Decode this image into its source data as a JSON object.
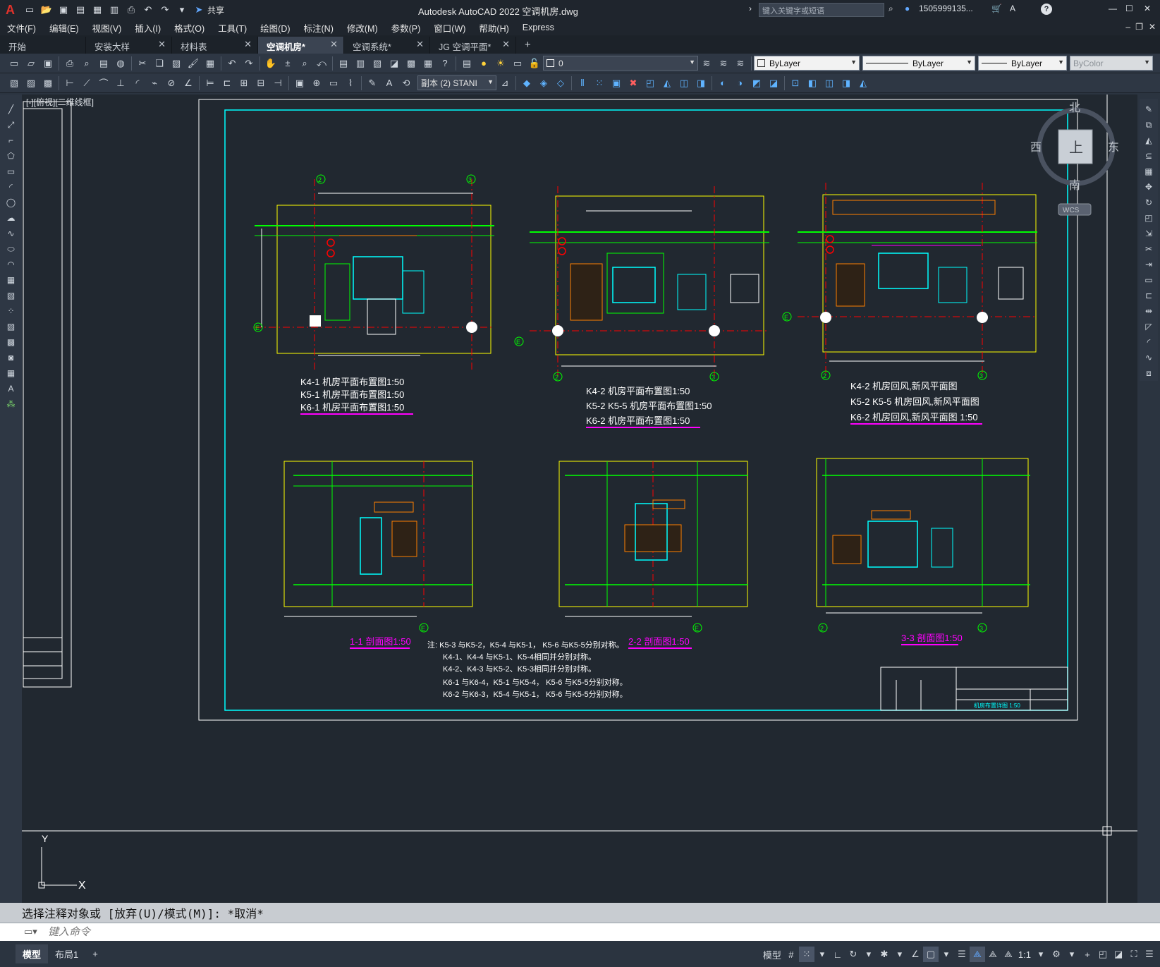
{
  "titlebar": {
    "app_logo": "A",
    "title": "Autodesk AutoCAD 2022    空调机房.dwg",
    "share_label": "共享",
    "search_placeholder": "键入关键字或短语",
    "user": "1505999135...",
    "help": "?"
  },
  "menu": [
    "文件(F)",
    "编辑(E)",
    "视图(V)",
    "插入(I)",
    "格式(O)",
    "工具(T)",
    "绘图(D)",
    "标注(N)",
    "修改(M)",
    "参数(P)",
    "窗口(W)",
    "帮助(H)",
    "Express"
  ],
  "tabs": [
    {
      "label": "开始",
      "closable": false,
      "active": false
    },
    {
      "label": "安装大样",
      "closable": true,
      "active": false
    },
    {
      "label": "材料表",
      "closable": true,
      "active": false
    },
    {
      "label": "空调机房*",
      "closable": true,
      "active": true
    },
    {
      "label": "空调系统*",
      "closable": true,
      "active": false
    },
    {
      "label": "JG 空调平面*",
      "closable": true,
      "active": false
    }
  ],
  "tab_add": "+",
  "properties": {
    "layer_value": "0",
    "color": "ByLayer",
    "linetype": "ByLayer",
    "lineweight": "ByLayer",
    "plotstyle": "ByColor",
    "dimstyle": "副本 (2) STANI"
  },
  "view_label": "[-][俯视][二维线框]",
  "viewcube": {
    "north": "北",
    "south": "南",
    "east": "东",
    "west": "西",
    "face": "上",
    "wcs": "WCS"
  },
  "ucs": {
    "x": "X",
    "y": "Y"
  },
  "drawing": {
    "plans": [
      {
        "lines": [
          "K4-1 机房平面布置图1:50",
          "K5-1 机房平面布置图1:50",
          "K6-1 机房平面布置图1:50"
        ]
      },
      {
        "lines": [
          "K4-2        机房平面布置图1:50",
          "K5-2 K5-5 机房平面布置图1:50",
          "K6-2         机房平面布置图1:50"
        ]
      },
      {
        "lines": [
          "K4-2          机房回风,新风平面图",
          "K5-2 K5-5 机房回风,新风平面图",
          "K6-2         机房回风,新风平面图    1:50"
        ]
      }
    ],
    "sections": [
      "1-1  剖面图1:50",
      "2-2  剖面图1:50",
      "3-3  剖面图1:50"
    ],
    "notes": [
      "注:  K5-3 与K5-2，K5-4 与K5-1，  K5-6 与K5-5分别对称。",
      "K4-1、K4-4 与K5-1、K5-4相同并分别对称。",
      "K4-2、K4-3 与K5-2、K5-3相同并分别对称。",
      "K6-1 与K6-4，K5-1 与K5-4，  K5-6 与K5-5分别对称。",
      "K6-2 与K6-3，K5-4 与K5-1，  K5-6 与K5-5分别对称。"
    ],
    "axis_labels": [
      "2",
      "3",
      "E"
    ],
    "titleblock_text": "机房布置详图 1:50"
  },
  "command": {
    "history": "选择注释对象或 [放弃(U)/模式(M)]: *取消*",
    "placeholder": "键入命令"
  },
  "status": {
    "layout_tabs": [
      "模型",
      "布局1"
    ],
    "add": "+",
    "model": "模型",
    "scale": "1:1"
  },
  "colors": {
    "canvas": "#212830",
    "cyan": "#00ffff",
    "yellow": "#ffff00",
    "green": "#00ff00",
    "red": "#ff0000",
    "magenta": "#ff00ff",
    "white": "#ffffff",
    "orange": "#ff7f00"
  }
}
